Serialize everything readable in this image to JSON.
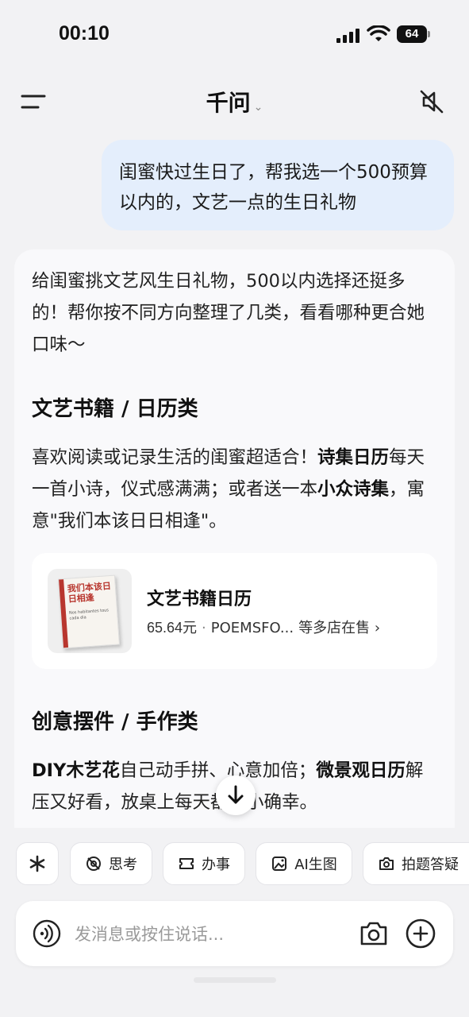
{
  "status_bar": {
    "time": "00:10",
    "battery": "64"
  },
  "header": {
    "title": "千问",
    "title_chevron": "⌄"
  },
  "chat": {
    "user_message": "闺蜜快过生日了，帮我选一个500预算以内的，文艺一点的生日礼物",
    "assistant": {
      "intro": "给闺蜜挑文艺风生日礼物，500以内选择还挺多的！帮你按不同方向整理了几类，看看哪种更合她口味～",
      "section1": {
        "heading": "文艺书籍 / 日历类",
        "text_a": "喜欢阅读或记录生活的闺蜜超适合！",
        "bold_a": "诗集日历",
        "text_b": "每天一首小诗，仪式感满满；或者送一本",
        "bold_b": "小众诗集",
        "text_c": "，寓意\"我们本该日日相逢\"。"
      },
      "product": {
        "name": "文艺书籍日历",
        "price": "65.64元",
        "separator": "·",
        "shop": "POEMSFO...",
        "more": "等多店在售 ›",
        "book_cover_title": "我们本该日日相逢",
        "book_cover_subtitle": "Nos habitantes tous cada dia"
      },
      "section2": {
        "heading": "创意摆件 / 手作类",
        "bold_a": "DIY木艺花",
        "text_a": "自己动手拼、心意加倍；",
        "bold_b": "微景观日历",
        "text_b": "解压又好看，放桌上每天都是小确幸。"
      }
    }
  },
  "chips": [
    {
      "label": "",
      "icon": "sparkle-icon"
    },
    {
      "label": "思考",
      "icon": "brain-icon"
    },
    {
      "label": "办事",
      "icon": "ticket-icon"
    },
    {
      "label": "AI生图",
      "icon": "image-icon"
    },
    {
      "label": "拍题答疑",
      "icon": "camera-icon"
    }
  ],
  "input": {
    "placeholder": "发消息或按住说话..."
  },
  "colors": {
    "user_bubble": "#e4eefc",
    "background": "#f2f2f4",
    "card": "#f9f9fb"
  }
}
